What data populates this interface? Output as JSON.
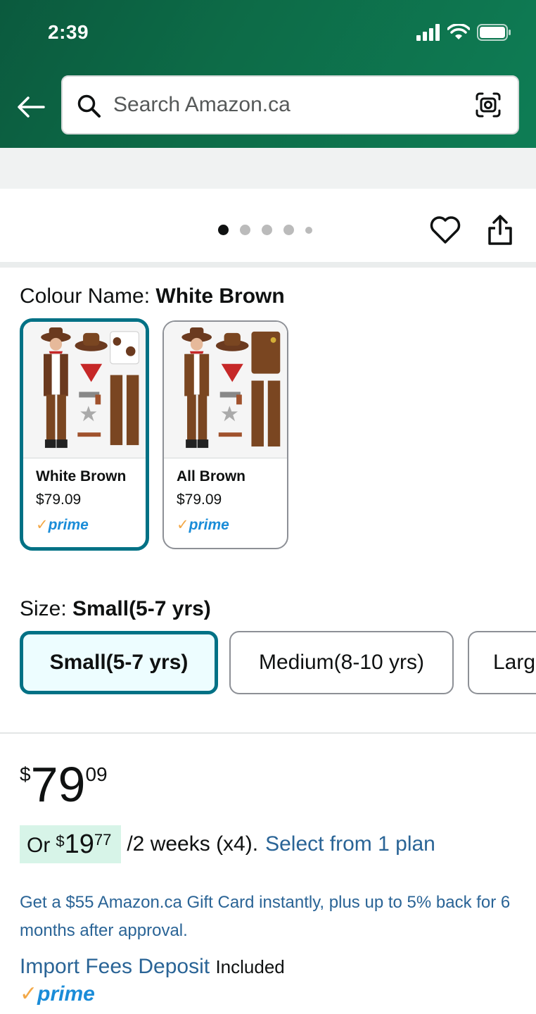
{
  "status_bar": {
    "time": "2:39"
  },
  "search": {
    "placeholder": "Search Amazon.ca"
  },
  "carousel": {
    "dot_count": 5,
    "active_index": 0
  },
  "colour": {
    "label": "Colour Name: ",
    "selected": "White Brown",
    "options": [
      {
        "name": "White Brown",
        "price": "$79.09",
        "badge": "prime",
        "selected": true
      },
      {
        "name": "All Brown",
        "price": "$79.09",
        "badge": "prime",
        "selected": false
      }
    ]
  },
  "size": {
    "label": "Size: ",
    "selected": "Small(5-7 yrs)",
    "options": [
      "Small(5-7 yrs)",
      "Medium(8-10 yrs)",
      "Larg"
    ]
  },
  "price": {
    "symbol": "$",
    "whole": "79",
    "fraction": "09"
  },
  "installment": {
    "prefix": "Or",
    "symbol": "$",
    "whole": "19",
    "fraction": "77",
    "terms": "/2 weeks (x4).",
    "link": "Select from 1 plan"
  },
  "gift_card_promo": "Get a $55 Amazon.ca Gift Card instantly, plus up to 5% back for 6 months after approval.",
  "import_fees": {
    "link": "Import Fees Deposit",
    "status": "Included"
  },
  "prime_badge": "prime",
  "colors": {
    "header": "#0d6b47",
    "accent": "#007185",
    "link": "#2a6496",
    "installment_bg": "#d7f4e8"
  }
}
